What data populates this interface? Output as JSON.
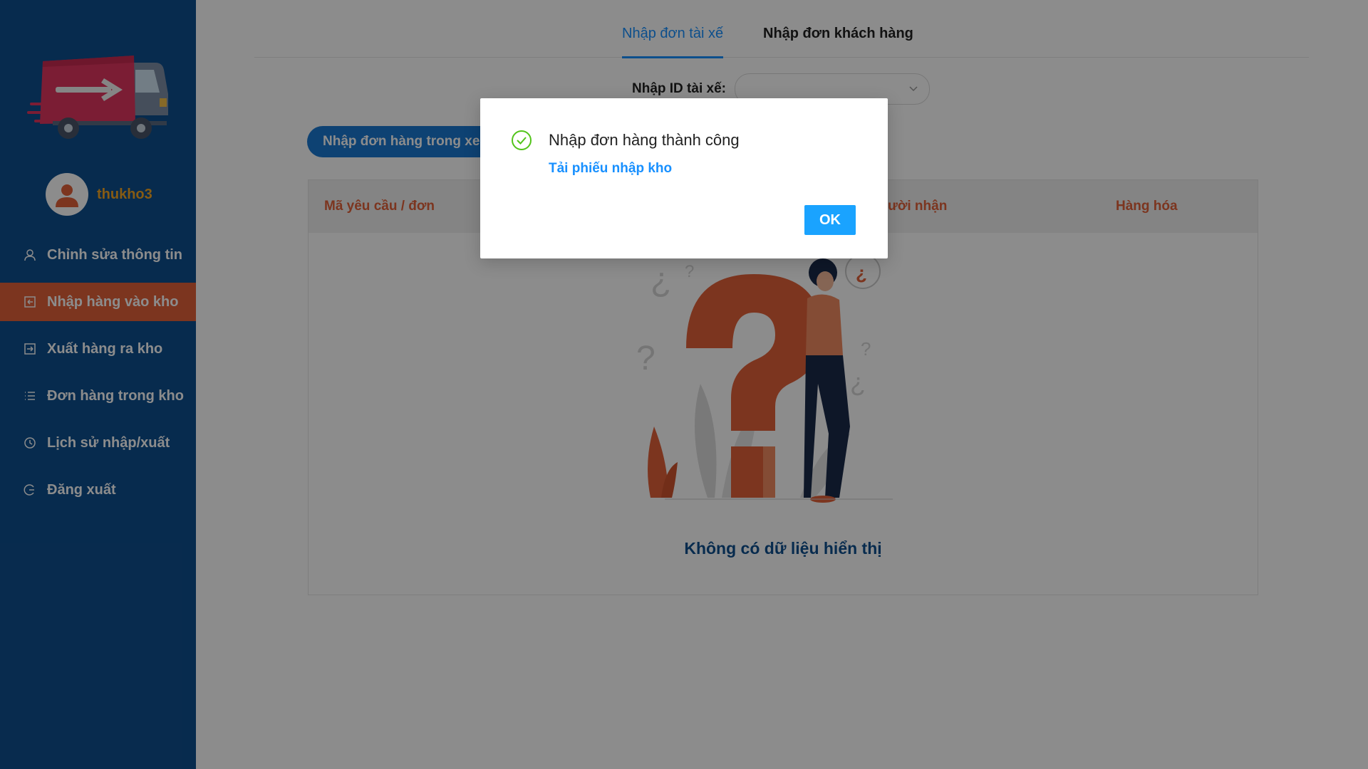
{
  "sidebar": {
    "username": "thukho3",
    "items": [
      {
        "label": "Chỉnh sửa thông tin",
        "icon": "user-icon"
      },
      {
        "label": "Nhập hàng vào kho",
        "icon": "import-icon",
        "active": true
      },
      {
        "label": "Xuất hàng ra kho",
        "icon": "export-icon"
      },
      {
        "label": "Đơn hàng trong kho",
        "icon": "list-icon"
      },
      {
        "label": "Lịch sử nhập/xuất",
        "icon": "history-icon"
      },
      {
        "label": "Đăng xuất",
        "icon": "logout-icon"
      }
    ]
  },
  "tabs": [
    {
      "label": "Nhập đơn tài xế",
      "active": true
    },
    {
      "label": "Nhập đơn khách hàng",
      "active": false
    }
  ],
  "driver": {
    "label": "Nhập ID tài xế:",
    "selected": ""
  },
  "import_button": "Nhập đơn hàng trong xe",
  "table": {
    "columns": [
      "Mã yêu cầu / đơn",
      "n người nhận",
      "Hàng hóa"
    ],
    "empty_text": "Không có dữ liệu hiển thị"
  },
  "modal": {
    "title": "Nhập đơn hàng thành công",
    "link": "Tải phiếu nhập kho",
    "ok": "OK"
  },
  "colors": {
    "sidebar": "#0e4f8e",
    "accent": "#e2613a",
    "primary": "#1890ff",
    "username": "#f5a623",
    "success": "#52c41a"
  }
}
